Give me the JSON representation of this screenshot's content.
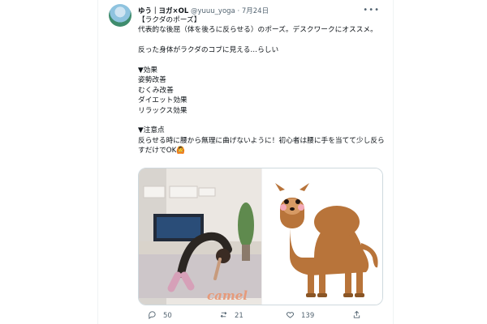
{
  "tweet": {
    "author_name": "ゆう｜ヨガ×OL",
    "handle": "@yuuu_yoga",
    "separator": "·",
    "date": "7月24日",
    "lines": [
      "【ラクダのポーズ】",
      "代表的な後屈（体を後ろに反らせる）のポーズ。デスクワークにオススメ。",
      "",
      "反った身体がラクダのコブに見える…らしい",
      "",
      "▼効果",
      "姿勢改善",
      "むくみ改善",
      "ダイエット効果",
      "リラックス効果",
      "",
      "▼注意点",
      "反らせる時に腰から無理に曲げないように！初心者は腰に手を当てて少し反らすだけでOK🙆"
    ],
    "media_caption": "camel",
    "actions": {
      "replies": "50",
      "retweets": "21",
      "likes": "139"
    }
  }
}
